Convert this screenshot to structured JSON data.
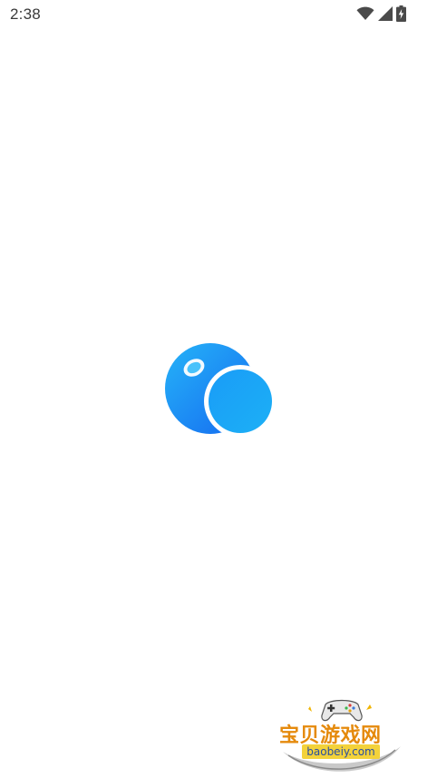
{
  "status_bar": {
    "time": "2:38",
    "icons": [
      "wifi-icon",
      "cellular-signal-icon",
      "battery-charging-icon"
    ]
  },
  "splash": {
    "logo": "bubble-logo-icon",
    "logo_colors": {
      "primary": "#1aa2f6",
      "dark": "#1677f2"
    }
  },
  "watermark": {
    "title": "宝贝游戏网",
    "url": "baobeiy.com",
    "title_color": "#e58a0c",
    "url_bg_color": "#f3d23a"
  }
}
